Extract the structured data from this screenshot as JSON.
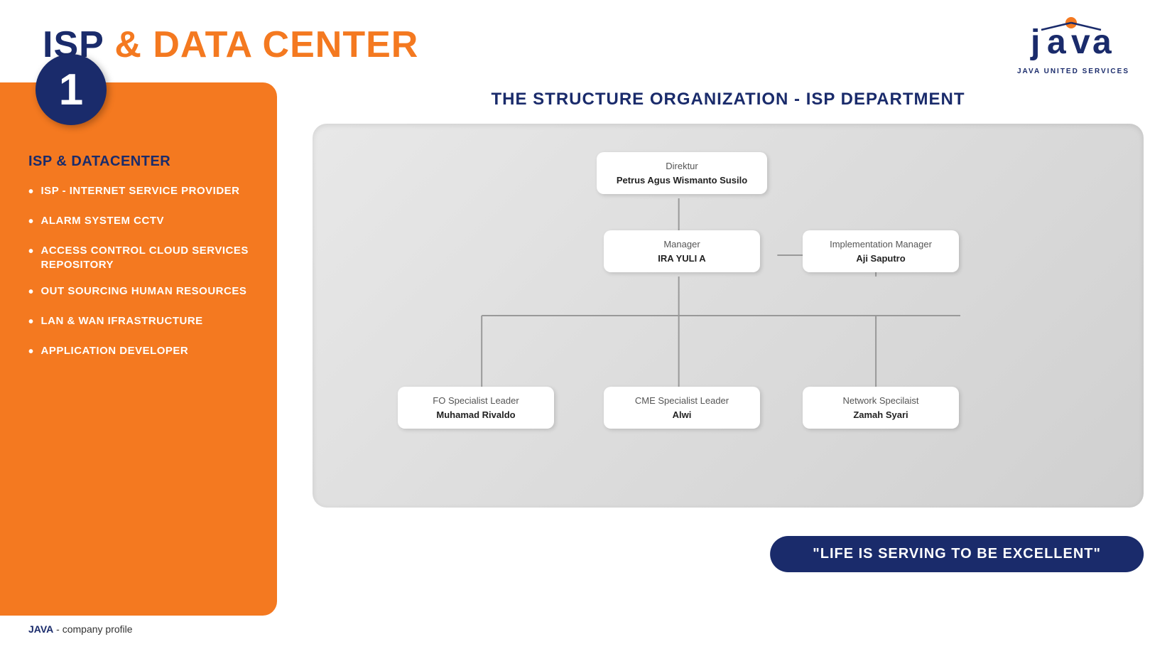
{
  "header": {
    "title_dark": "ISP",
    "title_ampersand": " & ",
    "title_orange": "DATA CENTER",
    "logo_brand": "java",
    "logo_subtitle": "JAVA UNITED SERVICES"
  },
  "sidebar": {
    "number": "1",
    "heading": "ISP & DATACENTER",
    "items": [
      {
        "label": "ISP - INTERNET SERVICE PROVIDER"
      },
      {
        "label": "ALARM SYSTEM CCTV"
      },
      {
        "label": "ACCESS CONTROL CLOUD SERVICES REPOSITORY"
      },
      {
        "label": "OUT SOURCING HUMAN RESOURCES"
      },
      {
        "label": "LAN & WAN IFRASTRUCTURE"
      },
      {
        "label": "APPLICATION DEVELOPER"
      }
    ]
  },
  "org_chart": {
    "title": "THE STRUCTURE ORGANIZATION - ISP DEPARTMENT",
    "nodes": {
      "direktur": {
        "line1": "Direktur",
        "line2": "Petrus Agus Wismanto Susilo"
      },
      "manager": {
        "line1": "Manager",
        "line2": "IRA YULI A"
      },
      "impl_manager": {
        "line1": "Implementation Manager",
        "line2": "Aji Saputro"
      },
      "fo_specialist": {
        "line1": "FO Specialist Leader",
        "line2": "Muhamad Rivaldo"
      },
      "cme_specialist": {
        "line1": "CME Specialist Leader",
        "line2": "Alwi"
      },
      "network_specialist": {
        "line1": "Network Specilaist",
        "line2": "Zamah Syari"
      }
    }
  },
  "tagline": "\"LIFE IS SERVING TO BE EXCELLENT\"",
  "footer": {
    "brand": "JAVA",
    "text": " -  company profile"
  }
}
